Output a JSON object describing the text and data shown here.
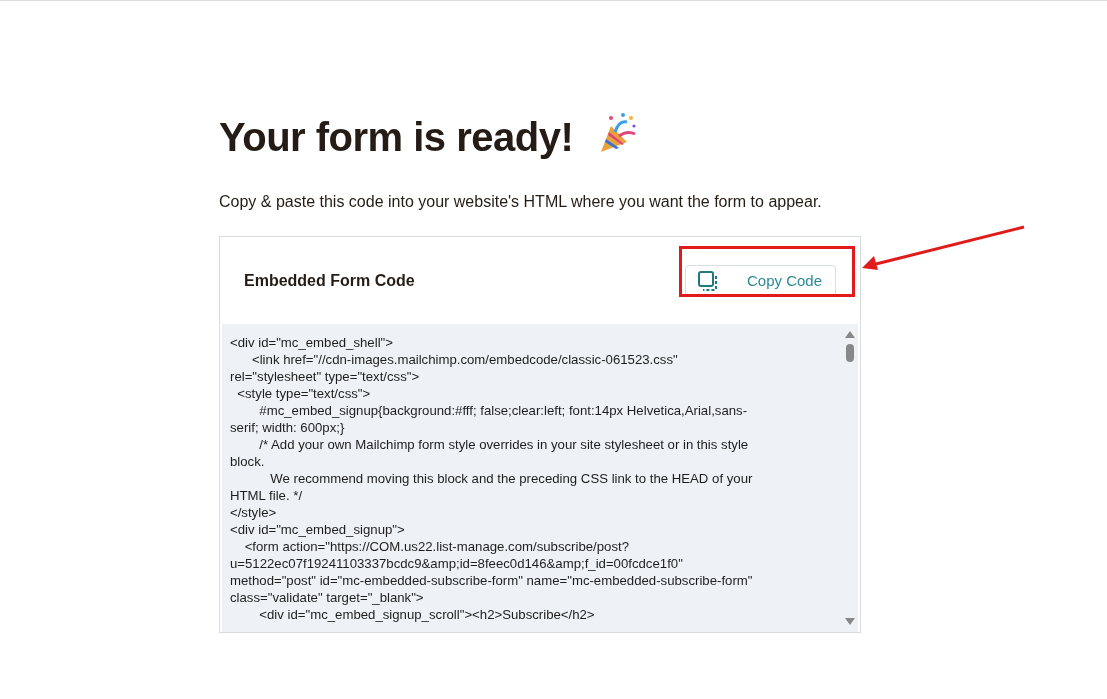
{
  "heading": "Your form is ready!",
  "instructions": "Copy & paste this code into your website's HTML where you want the form to appear.",
  "card": {
    "title": "Embedded Form Code",
    "copy_button": "Copy Code",
    "code_lines": [
      "<div id=\"mc_embed_shell\">",
      "      <link href=\"//cdn-images.mailchimp.com/embedcode/classic-061523.css\"",
      "rel=\"stylesheet\" type=\"text/css\">",
      "  <style type=\"text/css\">",
      "        #mc_embed_signup{background:#fff; false;clear:left; font:14px Helvetica,Arial,sans-",
      "serif; width: 600px;}",
      "        /* Add your own Mailchimp form style overrides in your site stylesheet or in this style",
      "block.",
      "           We recommend moving this block and the preceding CSS link to the HEAD of your",
      "HTML file. */",
      "</style>",
      "<div id=\"mc_embed_signup\">",
      "    <form action=\"https://COM.us22.list-manage.com/subscribe/post?",
      "u=5122ec07f19241103337bcdc9&amp;id=8feec0d146&amp;f_id=00fcdce1f0\"",
      "method=\"post\" id=\"mc-embedded-subscribe-form\" name=\"mc-embedded-subscribe-form\"",
      "class=\"validate\" target=\"_blank\">",
      "        <div id=\"mc_embed_signup_scroll\"><h2>Subscribe</h2>"
    ]
  }
}
